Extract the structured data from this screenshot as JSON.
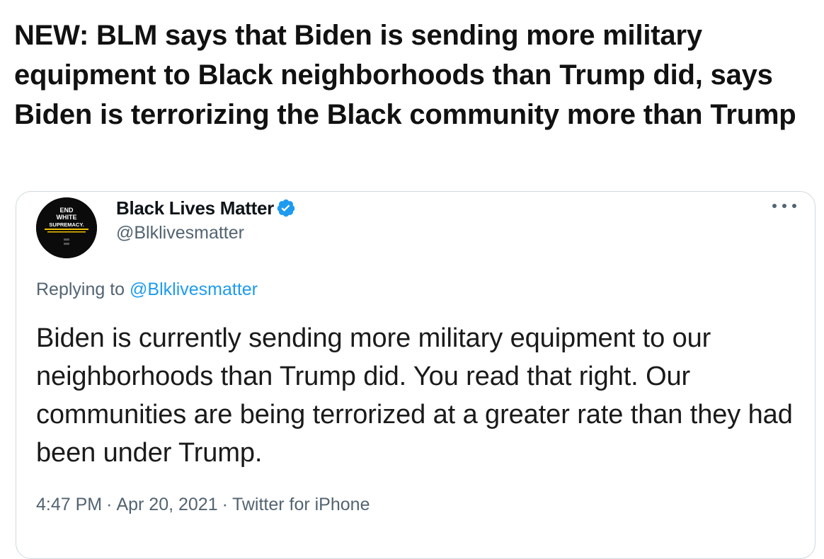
{
  "headline": "NEW: BLM says that Biden is sending more military equipment to Black neighborhoods than Trump did, says Biden is terrorizing the Black community more than Trump",
  "tweet": {
    "avatar": {
      "icon": "end-white-supremacy-logo",
      "lines": [
        "END",
        "WHITE",
        "SUPREMACY."
      ],
      "colors": {
        "background": "#0b0b0b",
        "text": "#ffffff",
        "stripe": "#f2c100"
      }
    },
    "author": {
      "name": "Black Lives Matter",
      "handle": "@Blklivesmatter",
      "verified_icon": "verified-badge-icon",
      "verified_color": "#1d9bf0"
    },
    "more_icon": "more-options-icon",
    "replying_prefix": "Replying to",
    "replying_handle": "@Blklivesmatter",
    "text": "Biden is currently sending more military equipment to our neighborhoods than Trump did. You read that right. Our communities are being terrorized at a greater rate than they had been under Trump.",
    "time": "4:47 PM",
    "date": "Apr 20, 2021",
    "source": "Twitter for iPhone",
    "separator": "·"
  }
}
